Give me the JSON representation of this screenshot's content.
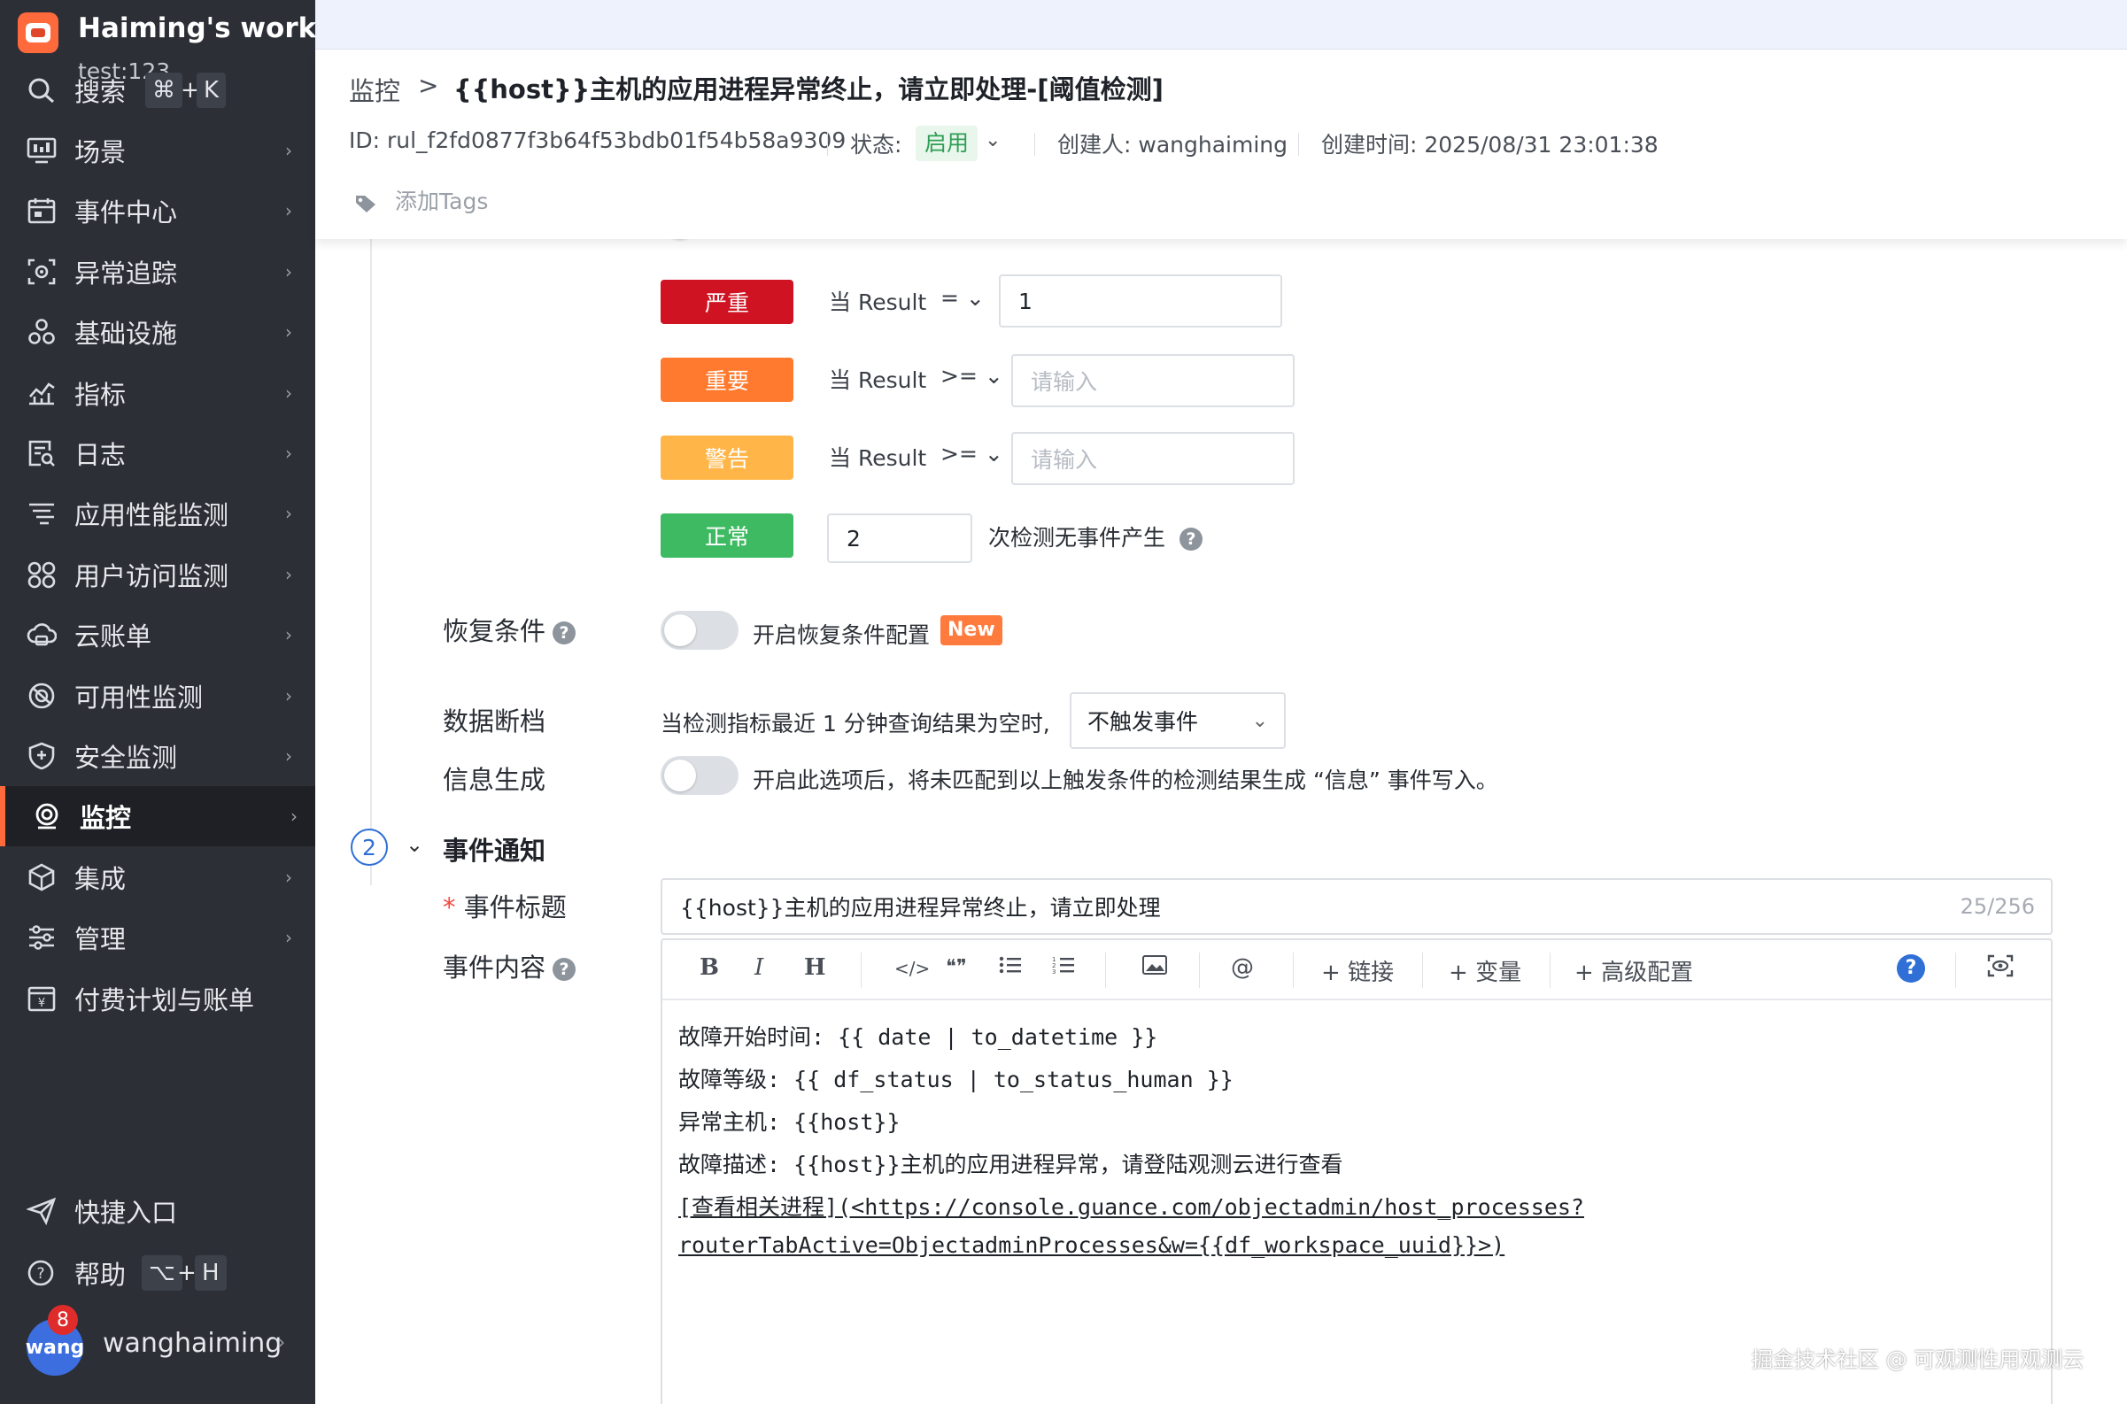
{
  "workspace": {
    "name": "Haiming's work...",
    "sub": "test:123"
  },
  "search": {
    "label": "搜索",
    "kbd_cmd": "⌘",
    "kbd_plus": "+",
    "kbd_key": "K"
  },
  "nav": {
    "items": [
      {
        "label": "场景",
        "icon": "monitor-icon"
      },
      {
        "label": "事件中心",
        "icon": "calendar-icon"
      },
      {
        "label": "异常追踪",
        "icon": "target-icon"
      },
      {
        "label": "基础设施",
        "icon": "cluster-icon"
      },
      {
        "label": "指标",
        "icon": "chart-icon"
      },
      {
        "label": "日志",
        "icon": "log-icon"
      },
      {
        "label": "应用性能监测",
        "icon": "apm-icon"
      },
      {
        "label": "用户访问监测",
        "icon": "rum-icon"
      },
      {
        "label": "云账单",
        "icon": "cloud-icon"
      },
      {
        "label": "可用性监测",
        "icon": "availability-icon"
      },
      {
        "label": "安全监测",
        "icon": "shield-icon"
      },
      {
        "label": "监控",
        "icon": "monitor-camera-icon"
      },
      {
        "label": "集成",
        "icon": "integration-icon"
      },
      {
        "label": "管理",
        "icon": "settings-icon"
      },
      {
        "label": "付费计划与账单",
        "icon": "billing-icon"
      }
    ],
    "shortcut": "快捷入口",
    "help": "帮助",
    "help_kbd_1": "⌥",
    "help_kbd_plus": "+",
    "help_kbd_2": "H"
  },
  "user": {
    "avatar_text": "wang",
    "badge": "8",
    "name": "wanghaiming"
  },
  "header": {
    "crumb": "监控",
    "crumb_sep": ">",
    "title": "{{host}}主机的应用进程异常终止，请立即处理-[阈值检测]",
    "id_label": "ID: rul_f2fd0877f3b64f53bdb01f54b58a9309",
    "status_label": "状态:",
    "status_value": "启用",
    "creator": "创建人: wanghaiming",
    "created": "创建时间: 2025/08/31 23:01:38",
    "add_tags": "添加Tags"
  },
  "levels": [
    {
      "label": "严重",
      "when": "当 Result",
      "op": "=",
      "value": "1",
      "placeholder": "",
      "color": "#cf1322"
    },
    {
      "label": "重要",
      "when": "当 Result",
      "op": ">=",
      "value": "",
      "placeholder": "请输入",
      "color": "#ff7a2e"
    },
    {
      "label": "警告",
      "when": "当 Result",
      "op": ">=",
      "value": "",
      "placeholder": "请输入",
      "color": "#ffb547"
    },
    {
      "label": "正常",
      "count": "2",
      "suffix": "次检测无事件产生",
      "color": "#3dba62"
    }
  ],
  "recovery": {
    "label": "恢复条件",
    "desc": "开启恢复条件配置",
    "new_badge": "New"
  },
  "data_gap": {
    "label": "数据断档",
    "desc": "当检测指标最近 1 分钟查询结果为空时,",
    "select": "不触发事件"
  },
  "info_gen": {
    "label": "信息生成",
    "desc": "开启此选项后，将未匹配到以上触发条件的检测结果生成 “信息” 事件写入。"
  },
  "notify": {
    "step": "2",
    "title": "事件通知"
  },
  "event_title": {
    "required": "*",
    "label": "事件标题",
    "value": "{{host}}主机的应用进程异常终止，请立即处理",
    "counter": "25/256"
  },
  "event_content": {
    "label": "事件内容",
    "toolbar": {
      "bold": "B",
      "italic": "I",
      "heading": "H",
      "code": "</>",
      "quote": "❝❞",
      "link": "链接",
      "variable": "变量",
      "advanced": "高级配置",
      "at": "@",
      "help": "?"
    },
    "lines": [
      "故障开始时间: {{ date | to_datetime }}",
      "故障等级: {{ df_status | to_status_human }}",
      "异常主机: {{host}}",
      "故障描述: {{host}}主机的应用进程异常，请登陆观测云进行查看",
      "[查看相关进程](<https://console.guance.com/objectadmin/host_processes?",
      "routerTabActive=ObjectadminProcesses&w={{df_workspace_uuid}}>)"
    ]
  },
  "watermark": "掘金技术社区 @ 可观测性用观测云"
}
